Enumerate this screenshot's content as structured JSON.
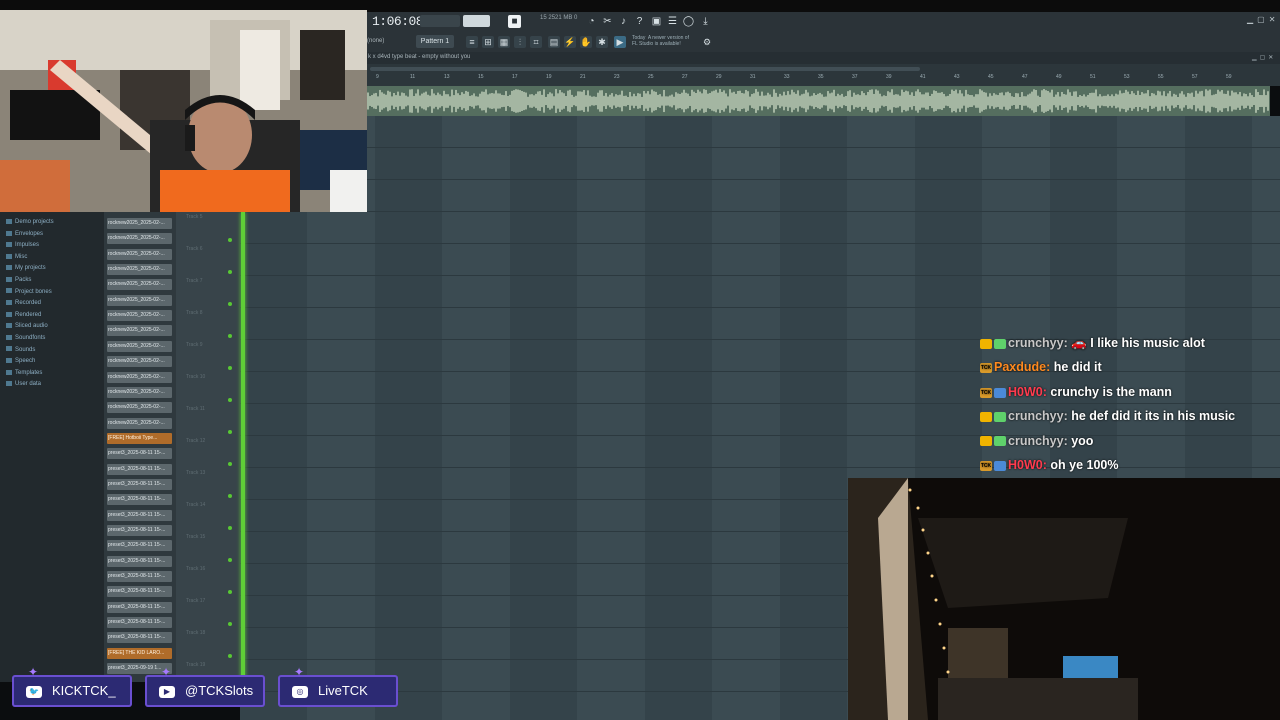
{
  "fl_studio": {
    "time": "1:06:08",
    "cpu_ram": "2521 MB\n0",
    "cpu_small": "15",
    "mode": "Pattern 1",
    "mode_left": "(none)",
    "news": "Today  A newer version of\nFL Studio is available!",
    "project_title": "k x d4vd type beat - empty without you",
    "ruler_numbers": [
      "9",
      "11",
      "13",
      "15",
      "17",
      "19",
      "21",
      "23",
      "25",
      "27",
      "29",
      "31",
      "33",
      "35",
      "37",
      "39",
      "41",
      "43",
      "45",
      "47",
      "49",
      "51",
      "53",
      "55",
      "57",
      "59"
    ]
  },
  "browser": {
    "items": [
      "Demo projects",
      "Envelopes",
      "Impulses",
      "Misc",
      "My projects",
      "Packs",
      "Project bones",
      "Recorded",
      "Rendered",
      "Sliced audio",
      "Soundfonts",
      "Sounds",
      "Speech",
      "Templates",
      "User data"
    ]
  },
  "channels": [
    "rocknew2025_2025-02-...",
    "rocknew2025_2025-02-...",
    "rocknew2025_2025-02-...",
    "rocknew2025_2025-02-...",
    "rocknew2025_2025-02-...",
    "rocknew2025_2025-02-...",
    "rocknew2025_2025-02-...",
    "rocknew2025_2025-02-...",
    "rocknew2025_2025-02-...",
    "rocknew2025_2025-02-...",
    "rocknew2025_2025-02-...",
    "rocknew2025_2025-02-...",
    "rocknew2025_2025-02-...",
    "rocknew2025_2025-02-...",
    "[FREE] Hotboii Type...",
    "preset3_2025-08-11 15-...",
    "preset3_2025-08-11 15-...",
    "preset3_2025-08-11 15-...",
    "preset3_2025-08-11 15-...",
    "preset3_2025-08-11 15-...",
    "preset3_2025-08-11 15-...",
    "preset3_2025-08-11 15-...",
    "preset3_2025-08-11 15-...",
    "preset3_2025-08-11 15-...",
    "preset3_2025-08-11 15-...",
    "preset3_2025-08-11 15-...",
    "preset3_2025-08-11 15-...",
    "preset3_2025-08-11 15-...",
    "[FREE] THE KID LARO...",
    "preset3_2025-09-19 1..."
  ],
  "tracks": [
    "Track 5",
    "Track 6",
    "Track 7",
    "Track 8",
    "Track 9",
    "Track 10",
    "Track 11",
    "Track 12",
    "Track 13",
    "Track 14",
    "Track 15",
    "Track 16",
    "Track 17",
    "Track 18",
    "Track 19"
  ],
  "chat": [
    {
      "user": "crunchyy:",
      "user_color": "#c8c8c8",
      "message": " 🚗 I like his music alot",
      "badges": [
        "crown",
        "gem"
      ]
    },
    {
      "user": "Paxdude:",
      "user_color": "#ff8a1f",
      "message": " he did it",
      "badges": [
        "tck"
      ]
    },
    {
      "user": "H0W0:",
      "user_color": "#ff3b4e",
      "message": " crunchy is the mann",
      "badges": [
        "tck",
        "blue"
      ]
    },
    {
      "user": "crunchyy:",
      "user_color": "#c8c8c8",
      "message": " he def did it its in his music",
      "badges": [
        "crown",
        "gem"
      ]
    },
    {
      "user": "crunchyy:",
      "user_color": "#c8c8c8",
      "message": " yoo",
      "badges": [
        "crown",
        "gem"
      ]
    },
    {
      "user": "H0W0:",
      "user_color": "#ff3b4e",
      "message": " oh ye 100%",
      "badges": [
        "tck",
        "blue"
      ]
    }
  ],
  "socials": [
    {
      "icon": "twitter-icon",
      "label": "KICKTCK_"
    },
    {
      "icon": "youtube-icon",
      "label": "@TCKSlots"
    },
    {
      "icon": "instagram-icon",
      "label": "LiveTCK"
    }
  ],
  "colors": {
    "playhead": "#5fcf37",
    "waveform": "#d9e7cf",
    "social_bg": "#2c2a73"
  }
}
